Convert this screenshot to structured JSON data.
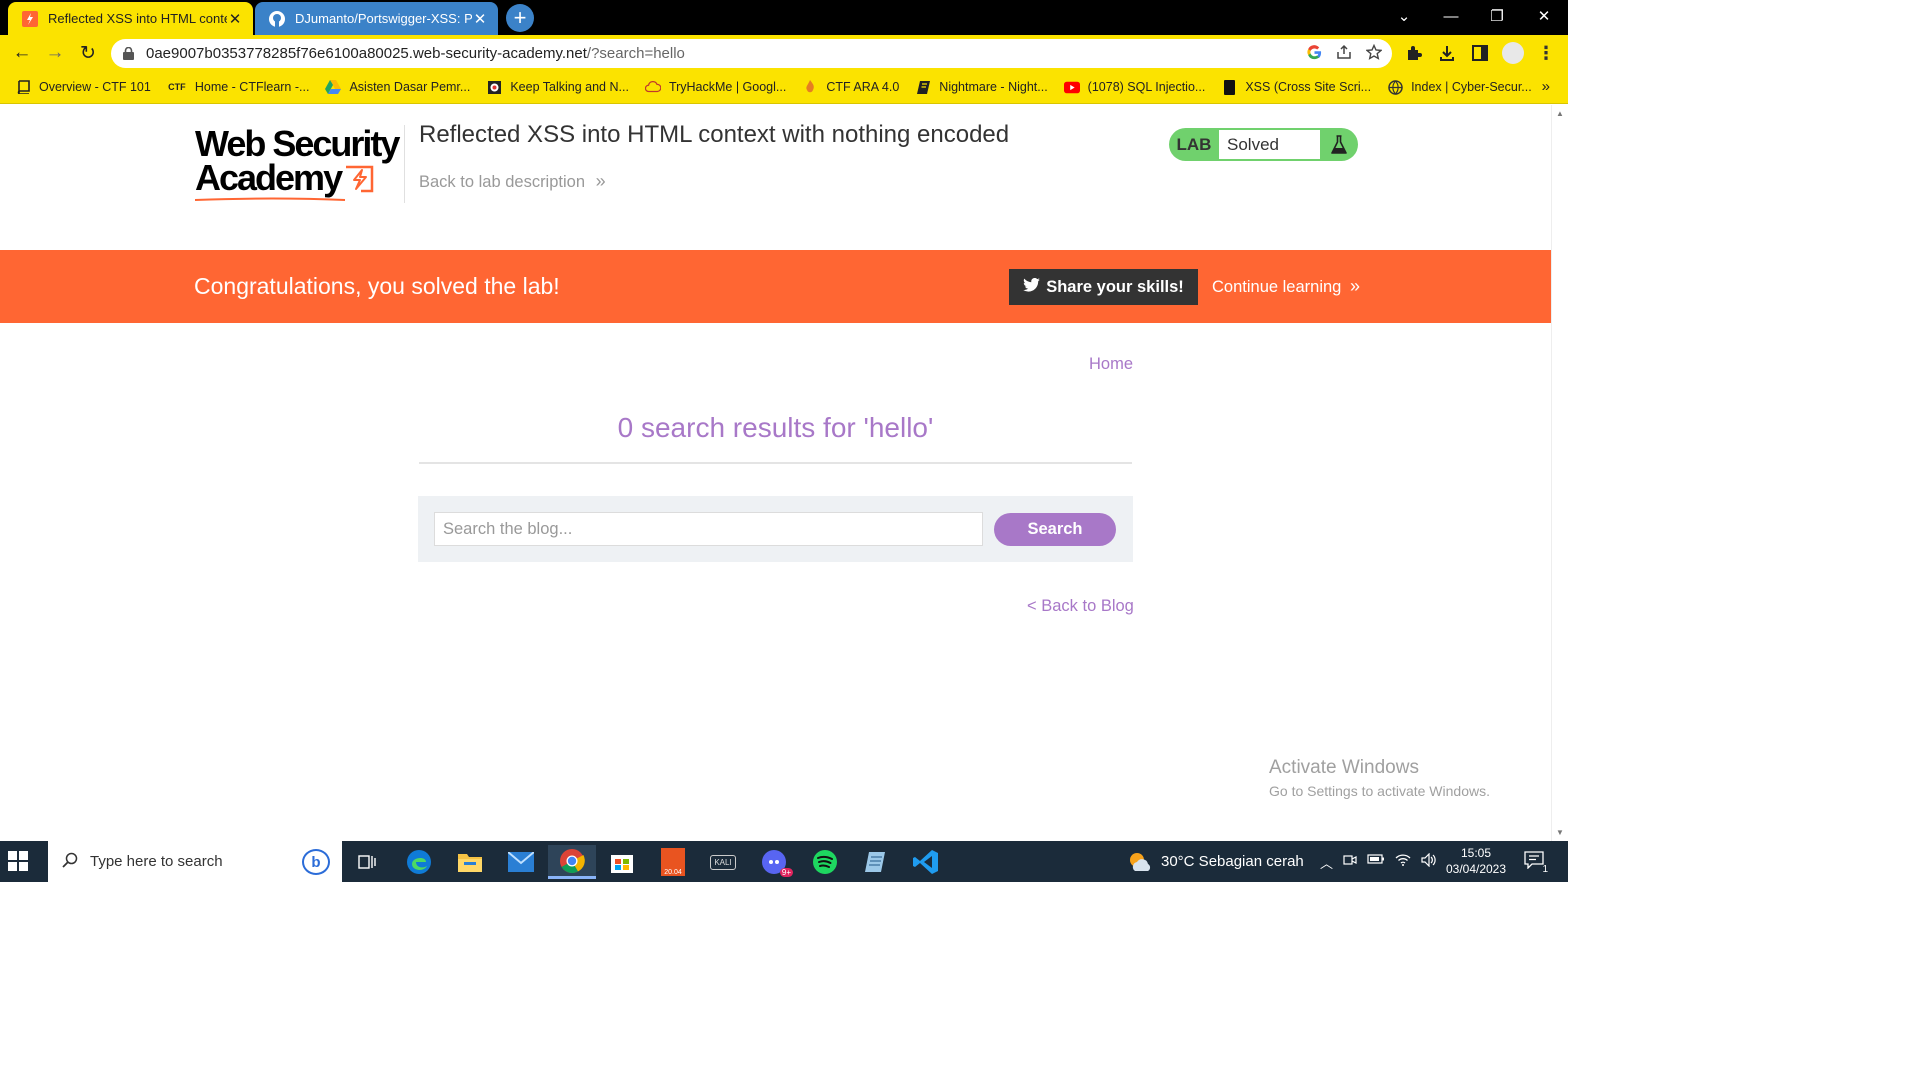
{
  "browser": {
    "tabs": [
      {
        "title": "Reflected XSS into HTML context"
      },
      {
        "title": "DJumanto/Portswigger-XSS: Port"
      }
    ],
    "new_tab_symbol": "+",
    "url_host": "0ae9007b0353778285f76e6100a80025.web-security-academy.net",
    "url_path": "/?search=hello",
    "bookmarks": [
      {
        "label": "Overview - CTF 101"
      },
      {
        "label": "Home - CTFlearn -..."
      },
      {
        "label": "Asisten Dasar Pemr..."
      },
      {
        "label": "Keep Talking and N..."
      },
      {
        "label": "TryHackMe | Googl..."
      },
      {
        "label": "CTF ARA 4.0"
      },
      {
        "label": "Nightmare - Night..."
      },
      {
        "label": "(1078) SQL Injectio..."
      },
      {
        "label": "XSS (Cross Site Scri..."
      },
      {
        "label": "Index | Cyber-Secur..."
      }
    ],
    "bookmark_ctf_icon": "CTF",
    "more_symbol": "»",
    "accent": "#fbe300",
    "inactive_tab": "#3b82c8"
  },
  "header": {
    "logo_line1": "Web Security",
    "logo_line2": "Academy",
    "lab_title": "Reflected XSS into HTML context with nothing encoded",
    "back_to_description": "Back to lab description",
    "chevrons": "»",
    "lab_label": "LAB",
    "lab_status": "Solved"
  },
  "banner": {
    "message": "Congratulations, you solved the lab!",
    "share_label": "Share your skills!",
    "continue_label": "Continue learning",
    "color": "#ff6633"
  },
  "main": {
    "home_link": "Home",
    "results_heading": "0 search results for 'hello'",
    "search_placeholder": "Search the blog...",
    "search_button": "Search",
    "back_to_blog": "< Back to Blog",
    "accent": "#a878c8"
  },
  "watermark": {
    "line1": "Activate Windows",
    "line2": "Go to Settings to activate Windows."
  },
  "taskbar": {
    "search_placeholder": "Type here to search",
    "ubuntu_version": "20.04",
    "kali_label": "KALI",
    "discord_badge": "9+",
    "weather": "30°C  Sebagian cerah",
    "time": "15:05",
    "date": "03/04/2023",
    "notification_count": "1"
  }
}
